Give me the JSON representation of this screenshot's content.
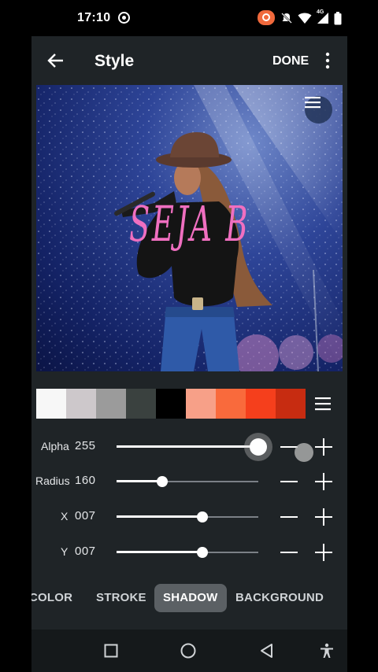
{
  "status_bar": {
    "time": "17:10",
    "network_label": "4G"
  },
  "toolbar": {
    "title": "Style",
    "done_label": "DONE"
  },
  "canvas": {
    "overlay_text": "SEJA B"
  },
  "palette": {
    "swatches": [
      "#f7f7f7",
      "#cdc8cb",
      "#9b9b9b",
      "#3a413f",
      "#000000",
      "#f7a088",
      "#f96a3c",
      "#f53f1c",
      "#c72c11"
    ]
  },
  "sliders": [
    {
      "label": "Alpha",
      "value": "255",
      "fraction": 1.0
    },
    {
      "label": "Radius",
      "value": "160",
      "fraction": 0.32
    },
    {
      "label": "X",
      "value": "007",
      "fraction": 0.605
    },
    {
      "label": "Y",
      "value": "007",
      "fraction": 0.605
    }
  ],
  "tabs": [
    {
      "label": "COLOR",
      "active": false
    },
    {
      "label": "STROKE",
      "active": false
    },
    {
      "label": "SHADOW",
      "active": true
    },
    {
      "label": "BACKGROUND",
      "active": false
    }
  ],
  "colors": {
    "app_bg": "#1f2427",
    "accent_text": "#f06fc0",
    "active_tab_bg": "#5b6064"
  }
}
